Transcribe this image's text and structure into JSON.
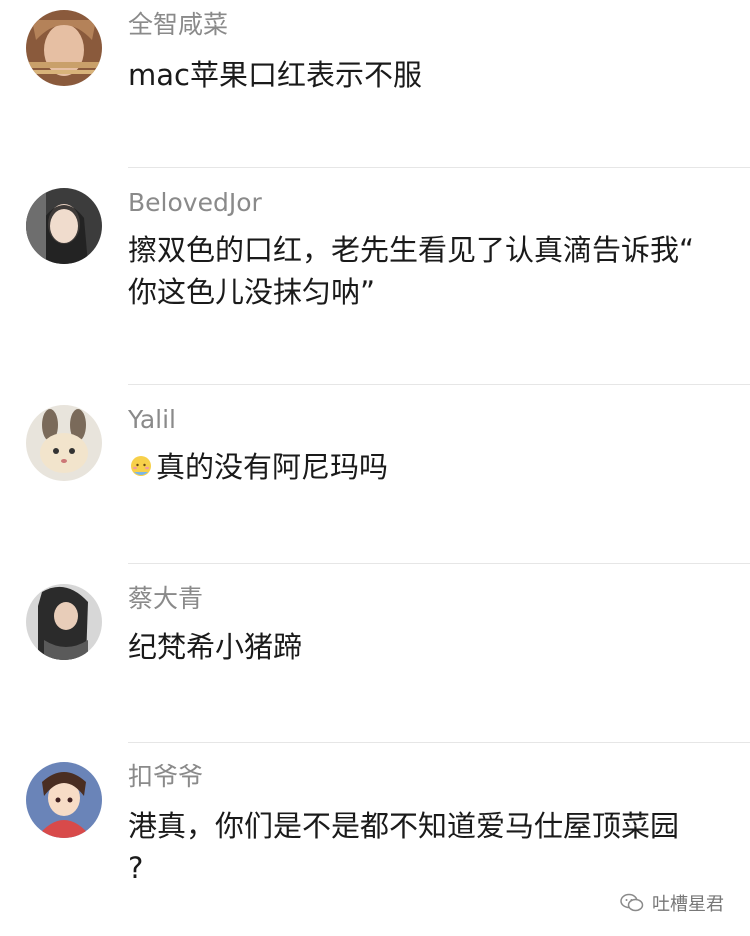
{
  "comments": [
    {
      "username": "全智咸菜",
      "lines": [
        "mac苹果口红表示不服"
      ]
    },
    {
      "username": "BelovedJor",
      "lines": [
        "擦双色的口红，老先生看见了认真滴告诉我“",
        "你这色儿没抹匀呐”"
      ]
    },
    {
      "username": "Yalil",
      "lines": [
        "真的没有阿尼玛吗"
      ],
      "emoji": "blushing-face-icon"
    },
    {
      "username": "蔡大青",
      "lines": [
        "纪梵希小猪蹄"
      ]
    },
    {
      "username": "扣爷爷",
      "lines": [
        "港真，你们是不是都不知道爱马仕屋顶菜园",
        "?"
      ]
    }
  ],
  "watermark": {
    "text": "吐槽星君",
    "icon": "wechat-icon"
  }
}
